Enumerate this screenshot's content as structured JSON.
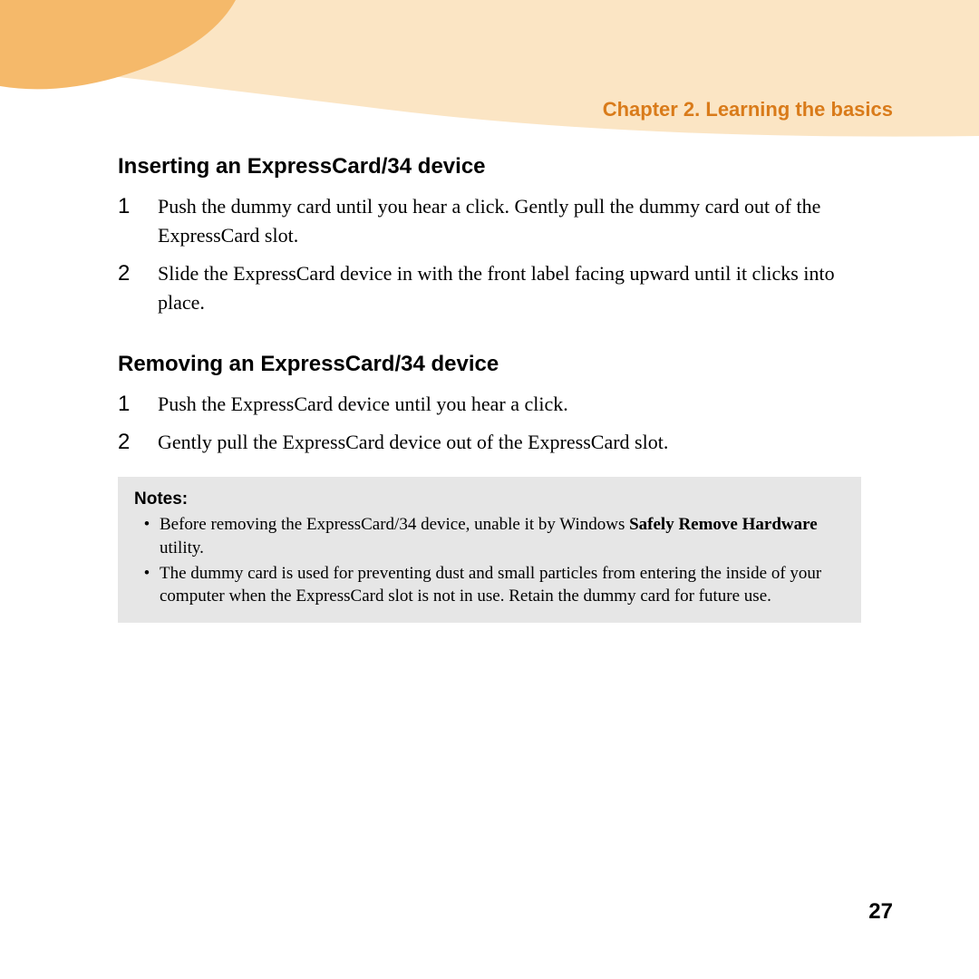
{
  "header": {
    "chapter_title": "Chapter 2. Learning the basics"
  },
  "sections": {
    "inserting": {
      "heading": "Inserting an ExpressCard/34 device",
      "steps": [
        {
          "num": "1",
          "text": "Push the dummy card until you hear a click. Gently pull the dummy card out of the ExpressCard slot."
        },
        {
          "num": "2",
          "text": "Slide the ExpressCard device in with the front label facing upward until it clicks into place."
        }
      ]
    },
    "removing": {
      "heading": "Removing an ExpressCard/34 device",
      "steps": [
        {
          "num": "1",
          "text": "Push the ExpressCard device until you hear a click."
        },
        {
          "num": "2",
          "text": "Gently pull the ExpressCard device out of the ExpressCard slot."
        }
      ]
    }
  },
  "notes": {
    "title": "Notes:",
    "items": {
      "n1_pre": "Before removing the ExpressCard/34 device, unable it by Windows ",
      "n1_bold": "Safely Remove Hardware",
      "n1_post": " utility.",
      "n2": "The dummy card is used for preventing dust and small particles from entering the inside of your computer when the ExpressCard slot is not in use. Retain the dummy card for future use."
    }
  },
  "page_number": "27"
}
